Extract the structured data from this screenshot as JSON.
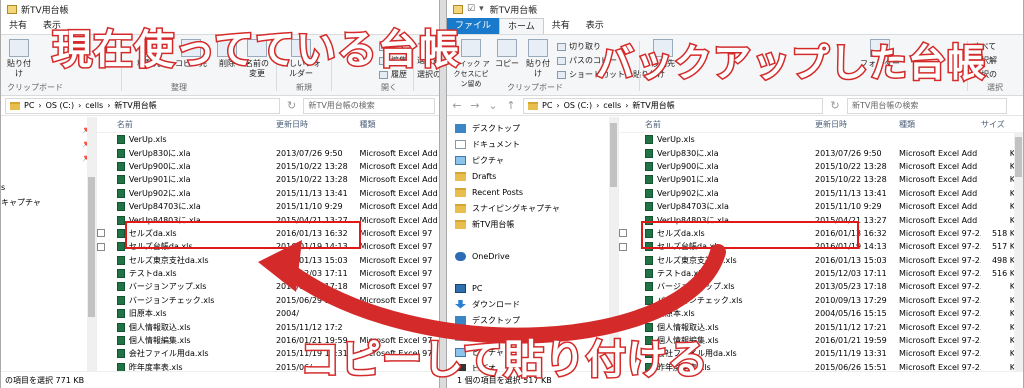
{
  "left_window": {
    "title": "新TV用台帳",
    "tabs": [
      "共有",
      "表示"
    ],
    "ribbon": {
      "paste": "貼り付け",
      "move_to": "移動先",
      "copy_to": "コピー先",
      "delete": "削除",
      "rename": "名前の変更",
      "new_folder": "新しいフォルダー",
      "properties": "プロパティ",
      "open": "開く",
      "edit": "編集",
      "history": "履歴",
      "select_all": "すべて選",
      "select_none": "選択解",
      "invert": "選択の",
      "group_clipboard": "クリップボード",
      "group_organize": "整理",
      "group_new": "新規",
      "group_open": "開く"
    },
    "address": [
      "PC",
      "OS (C:)",
      "cells",
      "新TV用台帳"
    ],
    "search_placeholder": "新TV用台帳の検索",
    "columns": [
      "名前",
      "更新日時",
      "種類"
    ],
    "nav_items": [
      "s",
      "キャプチャ"
    ],
    "rows": [
      {
        "name": "VerUp.xls",
        "date": "",
        "type": ""
      },
      {
        "name": "VerUp830に.xla",
        "date": "2013/07/26 9:50",
        "type": "Microsoft Excel Add"
      },
      {
        "name": "VerUp900に.xla",
        "date": "2015/10/22 13:28",
        "type": "Microsoft Excel Add"
      },
      {
        "name": "VerUp901に.xla",
        "date": "2015/10/22 13:28",
        "type": "Microsoft Excel Add"
      },
      {
        "name": "VerUp902に.xla",
        "date": "2015/11/13 13:41",
        "type": "Microsoft Excel Add"
      },
      {
        "name": "VerUp84703に.xla",
        "date": "2015/11/10 9:29",
        "type": "Microsoft Excel Add"
      },
      {
        "name": "VerUp84803に.xla",
        "date": "2015/04/21 13:27",
        "type": "Microsoft Excel Add"
      },
      {
        "name": "セルズda.xls",
        "date": "2016/01/13 16:32",
        "type": "Microsoft Excel 97"
      },
      {
        "name": "セルズ台帳da.xls",
        "date": "2016/01/19 14:13",
        "type": "Microsoft Excel 97"
      },
      {
        "name": "セルズ東京支社da.xls",
        "date": "2016/01/13 15:03",
        "type": "Microsoft Excel 97"
      },
      {
        "name": "テストda.xls",
        "date": "2015/12/03 17:11",
        "type": "Microsoft Excel 97"
      },
      {
        "name": "バージョンアップ.xls",
        "date": "2013/05/23 17:18",
        "type": "Microsoft Excel 97"
      },
      {
        "name": "バージョンチェック.xls",
        "date": "2015/06/29 17:29",
        "type": "Microsoft Excel 97"
      },
      {
        "name": "旧原本.xls",
        "date": "2004/",
        "type": ""
      },
      {
        "name": "個人情報取込.xls",
        "date": "2015/11/12 17:2",
        "type": ""
      },
      {
        "name": "個人情報編集.xls",
        "date": "2016/01/21 19:59",
        "type": "Microsoft Excel 97"
      },
      {
        "name": "会社ファイル用da.xls",
        "date": "2015/11/19 13:31",
        "type": "Microsoft Excel 97"
      },
      {
        "name": "昨年度率表.xls",
        "date": "2015/06/",
        "type": ""
      }
    ],
    "status": "の項目を選択  771 KB"
  },
  "right_window": {
    "title": "新TV用台帳",
    "tabs": [
      "ファイル",
      "ホーム",
      "共有",
      "表示"
    ],
    "ribbon": {
      "quick_access": "クイック アクセスにピン留め",
      "copy": "コピー",
      "paste": "貼り付け",
      "cut": "切り取り",
      "copy_path": "パスのコピー",
      "paste_shortcut": "ショートカットの貼り付け",
      "move_to": "移動先",
      "new_folder": "フォルダー",
      "select_all": "すべて",
      "select_none": "選択解",
      "invert": "選択の",
      "group_clipboard": "クリップボード",
      "group_select": "選択"
    },
    "address": [
      "PC",
      "OS (C:)",
      "cells",
      "新TV用台帳"
    ],
    "search_placeholder": "新TV用台帳の検索",
    "columns": [
      "名前",
      "更新日時",
      "種類",
      "サイズ"
    ],
    "nav_items": [
      {
        "label": "デスクトップ",
        "icon": "desktop-icon"
      },
      {
        "label": "ドキュメント",
        "icon": "document-icon"
      },
      {
        "label": "ピクチャ",
        "icon": "picture-icon"
      },
      {
        "label": "Drafts",
        "icon": "folder-icon"
      },
      {
        "label": "Recent Posts",
        "icon": "folder-icon"
      },
      {
        "label": "スナイピングキャプチャ",
        "icon": "folder-icon"
      },
      {
        "label": "新TV用台帳",
        "icon": "folder-icon"
      },
      {
        "label": "",
        "icon": ""
      },
      {
        "label": "OneDrive",
        "icon": "onedrive-icon"
      },
      {
        "label": "",
        "icon": ""
      },
      {
        "label": "PC",
        "icon": "pc-icon"
      },
      {
        "label": "ダウンロード",
        "icon": "download-icon"
      },
      {
        "label": "デスクトップ",
        "icon": "desktop-icon"
      },
      {
        "label": "ドキュメント",
        "icon": "document-icon"
      },
      {
        "label": "ピクチャ",
        "icon": "picture-icon"
      },
      {
        "label": "ビデオ",
        "icon": "video-icon"
      },
      {
        "label": "OS (C:)",
        "icon": "drive-icon"
      }
    ],
    "rows": [
      {
        "name": "VerUp.xls",
        "date": "",
        "type": "",
        "size": ""
      },
      {
        "name": "VerUp830に.xla",
        "date": "2013/07/26 9:50",
        "type": "Microsoft Excel Add",
        "size": "K"
      },
      {
        "name": "VerUp900に.xla",
        "date": "2015/10/22 13:28",
        "type": "Microsoft Excel Add",
        "size": "K"
      },
      {
        "name": "VerUp901に.xla",
        "date": "2015/10/22 13:28",
        "type": "Microsoft Excel Add",
        "size": "K"
      },
      {
        "name": "VerUp902に.xla",
        "date": "2015/11/13 13:41",
        "type": "Microsoft Excel Add",
        "size": "K"
      },
      {
        "name": "VerUp84703に.xla",
        "date": "2015/11/10 9:29",
        "type": "Microsoft Excel Add",
        "size": "K"
      },
      {
        "name": "VerUp84803に.xla",
        "date": "2015/04/21 13:27",
        "type": "Microsoft Excel Add",
        "size": "K"
      },
      {
        "name": "セルズda.xls",
        "date": "2016/01/13 16:32",
        "type": "Microsoft Excel 97-2...",
        "size": "518 K"
      },
      {
        "name": "セルズ台帳da.xls",
        "date": "2016/01/19 14:13",
        "type": "Microsoft Excel 97-2...",
        "size": "517 K"
      },
      {
        "name": "セルズ東京支社da.xls",
        "date": "2016/01/13 15:03",
        "type": "Microsoft Excel 97-2...",
        "size": "498 K"
      },
      {
        "name": "テストda.xls",
        "date": "2015/12/03 17:11",
        "type": "Microsoft Excel 97-2...",
        "size": "516 K"
      },
      {
        "name": "バージョンアップ.xls",
        "date": "2013/05/23 17:18",
        "type": "Microsoft Excel 97-2...",
        "size": "K"
      },
      {
        "name": "バージョンチェック.xls",
        "date": "2010/09/13 17:29",
        "type": "Microsoft Excel 97-2...",
        "size": "K"
      },
      {
        "name": "旧原本.xls",
        "date": "2004/05/16 15:15",
        "type": "Microsoft Excel 97-2...",
        "size": "K"
      },
      {
        "name": "個人情報取込.xls",
        "date": "2015/11/12 17:21",
        "type": "Microsoft Excel 97-2...",
        "size": "K"
      },
      {
        "name": "個人情報編集.xls",
        "date": "2016/01/21 19:59",
        "type": "Microsoft Excel 97-2...",
        "size": "K"
      },
      {
        "name": "会社ファイル用da.xls",
        "date": "2015/11/19 13:31",
        "type": "Microsoft Excel 97-2...",
        "size": "K"
      },
      {
        "name": "昨年度率表.xls",
        "date": "2015/06/26 15:51",
        "type": "Microsoft Excel 97-2...",
        "size": "K"
      }
    ],
    "status": "1 個の項目を選択  517 KB"
  },
  "annotations": {
    "left_caption": "現在使ってている台帳",
    "right_caption": "バックアップした台帳",
    "bottom_caption": "コピーして貼り付ける",
    "accent_color": "#d42a2a",
    "box_color": "#e01818"
  }
}
